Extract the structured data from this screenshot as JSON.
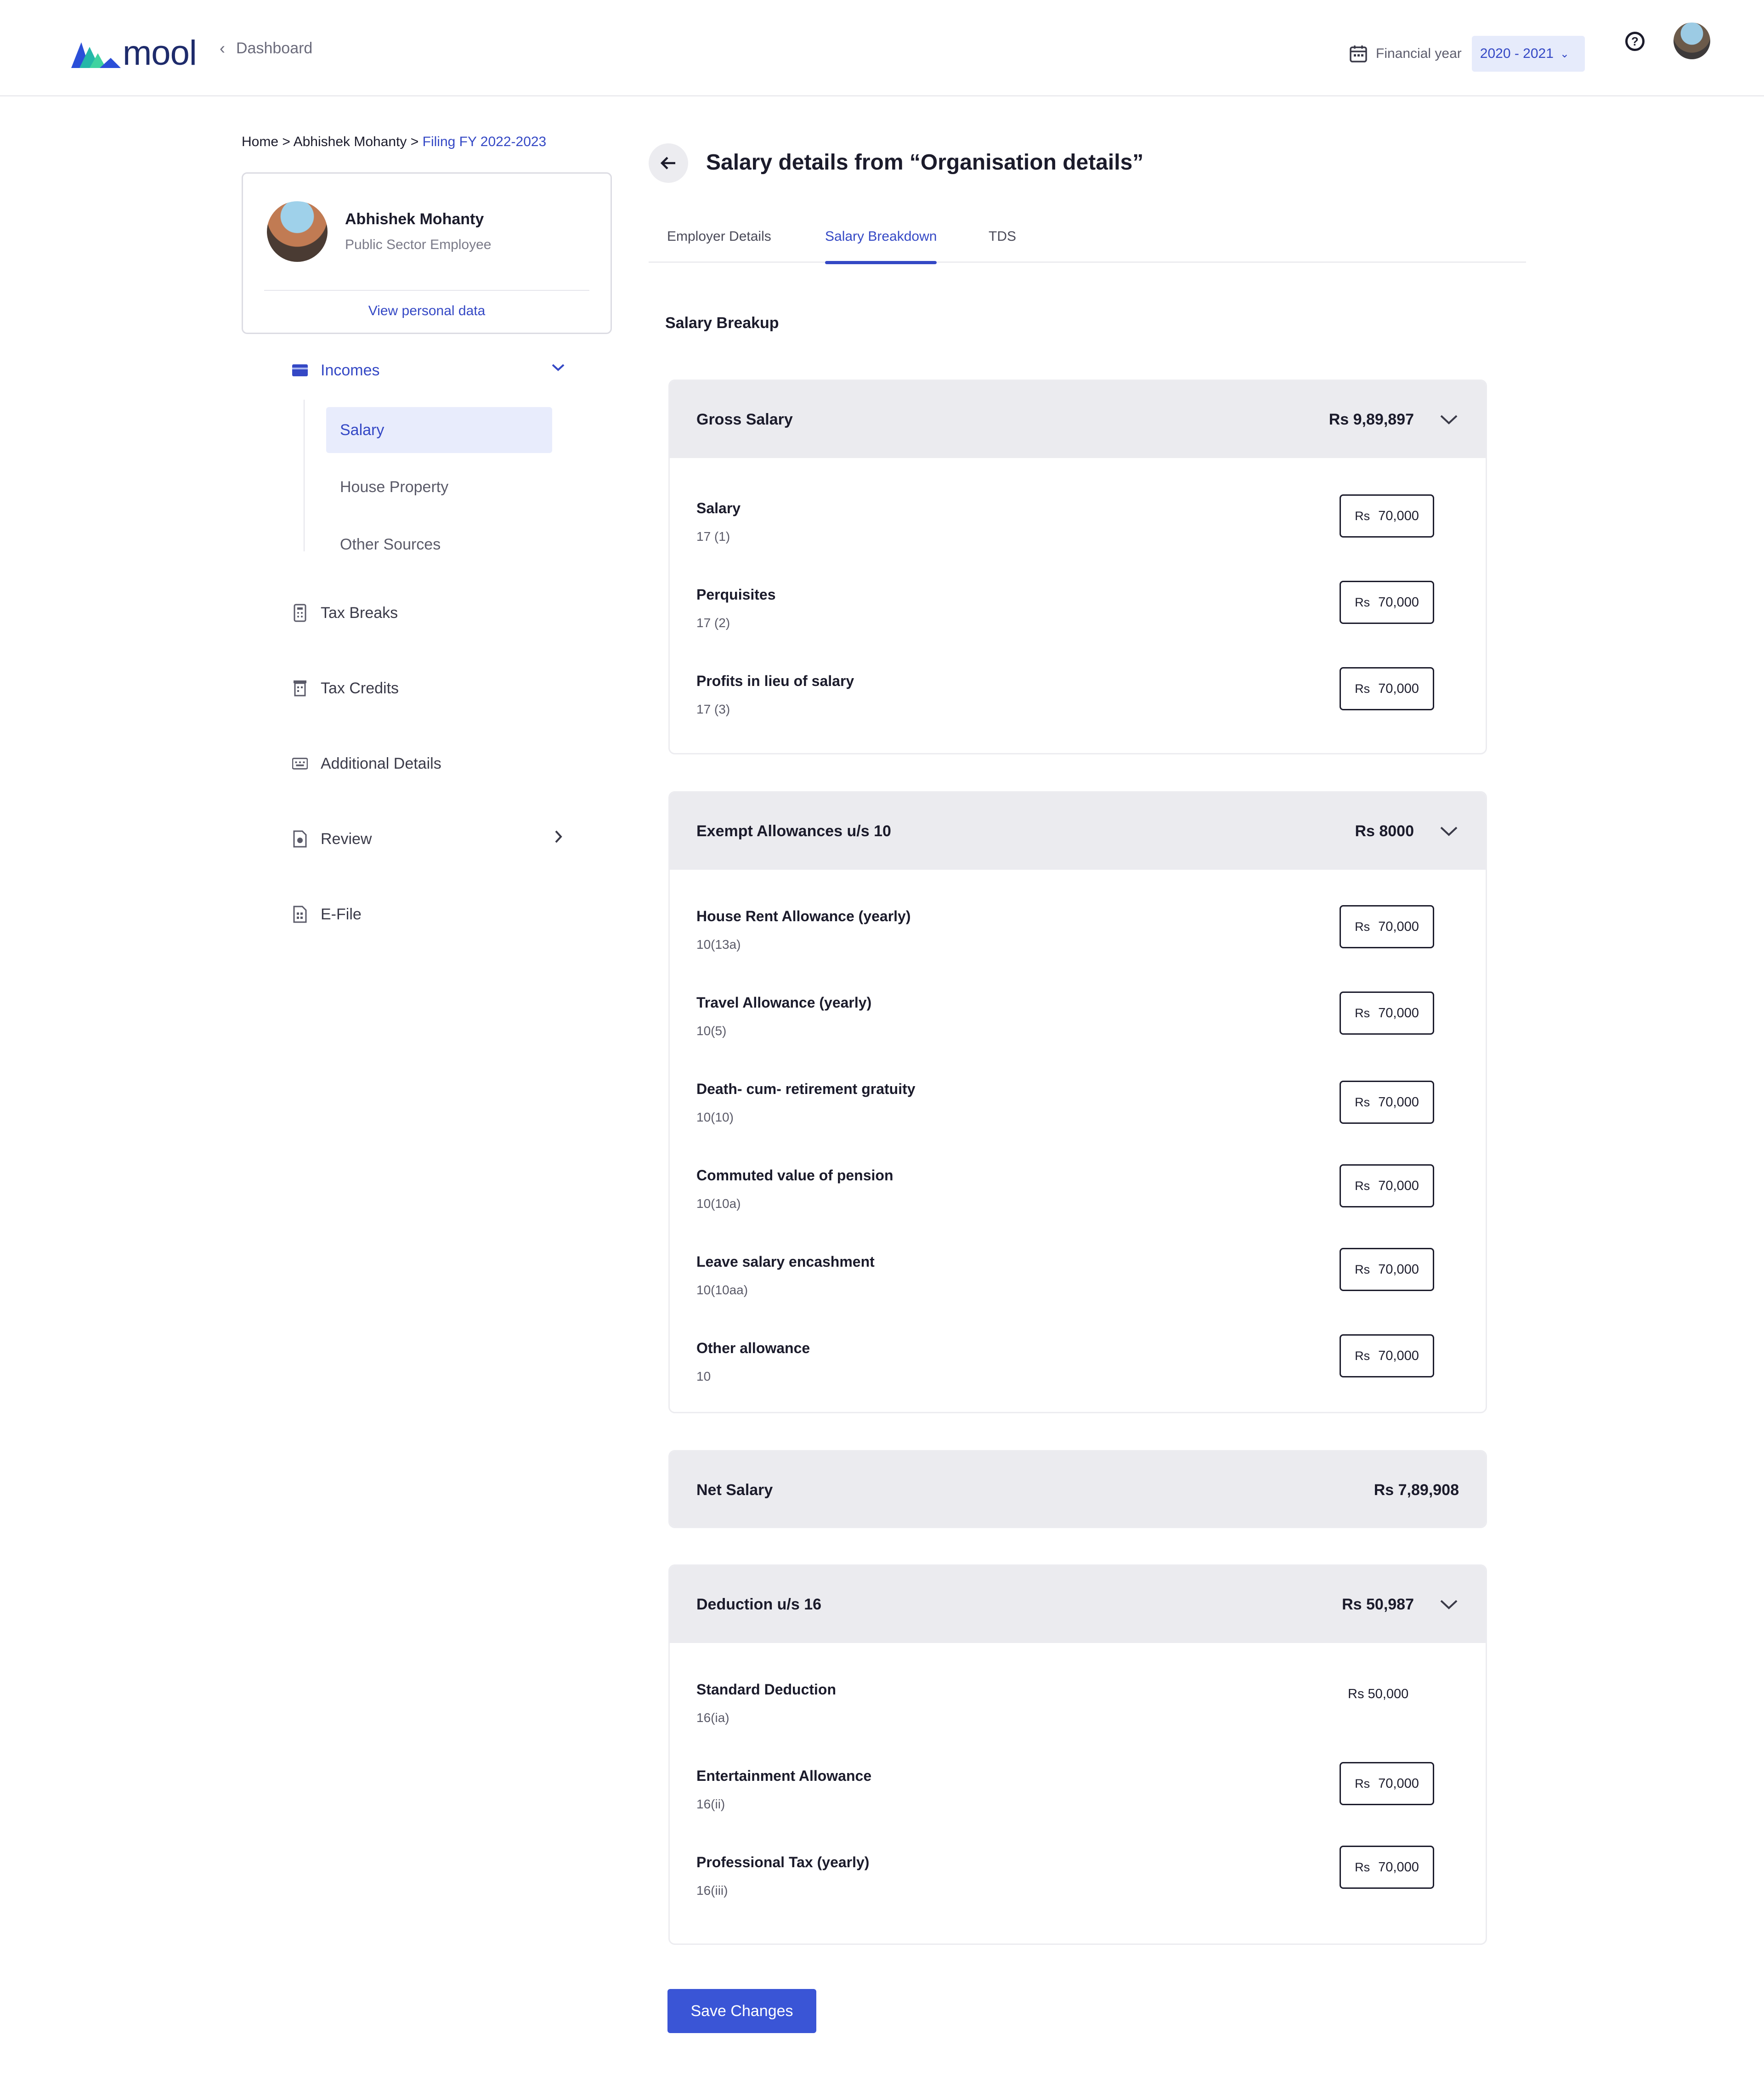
{
  "header": {
    "logo_text": "mool",
    "back_link": "Dashboard",
    "fy_label": "Financial year",
    "fy_value": "2020 - 2021"
  },
  "breadcrumb": {
    "items": [
      "Home",
      "Abhishek Mohanty",
      "Filing FY 2022-2023"
    ],
    "separator": ">"
  },
  "profile": {
    "name": "Abhishek Mohanty",
    "role": "Public Sector Employee",
    "link": "View personal data"
  },
  "nav": {
    "incomes": "Incomes",
    "sub": [
      "Salary",
      "House Property",
      "Other Sources"
    ],
    "tax_breaks": "Tax Breaks",
    "tax_credits": "Tax Credits",
    "additional": "Additional Details",
    "review": "Review",
    "efile": "E-File"
  },
  "main": {
    "title": "Salary details from “Organisation details”",
    "tabs": [
      "Employer Details",
      "Salary Breakdown",
      "TDS"
    ],
    "active_tab": "Salary Breakdown",
    "section_heading": "Salary Breakup",
    "currency": "Rs",
    "gross": {
      "title": "Gross Salary",
      "total": "Rs 9,89,897",
      "rows": [
        {
          "label": "Salary",
          "code": "17 (1)",
          "value": "70,000"
        },
        {
          "label": "Perquisites",
          "code": "17 (2)",
          "value": "70,000"
        },
        {
          "label": "Profits in lieu of salary",
          "code": "17 (3)",
          "value": "70,000"
        }
      ]
    },
    "exempt": {
      "title": "Exempt Allowances u/s 10",
      "total": "Rs 8000",
      "rows": [
        {
          "label": "House Rent Allowance (yearly)",
          "code": "10(13a)",
          "value": "70,000"
        },
        {
          "label": "Travel Allowance (yearly)",
          "code": "10(5)",
          "value": "70,000"
        },
        {
          "label": "Death- cum- retirement gratuity",
          "code": "10(10)",
          "value": "70,000"
        },
        {
          "label": "Commuted value of pension",
          "code": "10(10a)",
          "value": "70,000"
        },
        {
          "label": "Leave salary encashment",
          "code": "10(10aa)",
          "value": "70,000"
        },
        {
          "label": "Other allowance",
          "code": "10",
          "value": "70,000"
        }
      ]
    },
    "net": {
      "title": "Net Salary",
      "total": "Rs 7,89,908"
    },
    "deduction": {
      "title": "Deduction u/s 16",
      "total": "Rs 50,987",
      "rows": [
        {
          "label": "Standard Deduction",
          "code": "16(ia)",
          "value": "Rs 50,000"
        },
        {
          "label": "Entertainment Allowance",
          "code": "16(ii)",
          "value": "70,000"
        },
        {
          "label": "Professional Tax (yearly)",
          "code": "16(iii)",
          "value": "70,000"
        }
      ]
    },
    "save_label": "Save Changes"
  }
}
